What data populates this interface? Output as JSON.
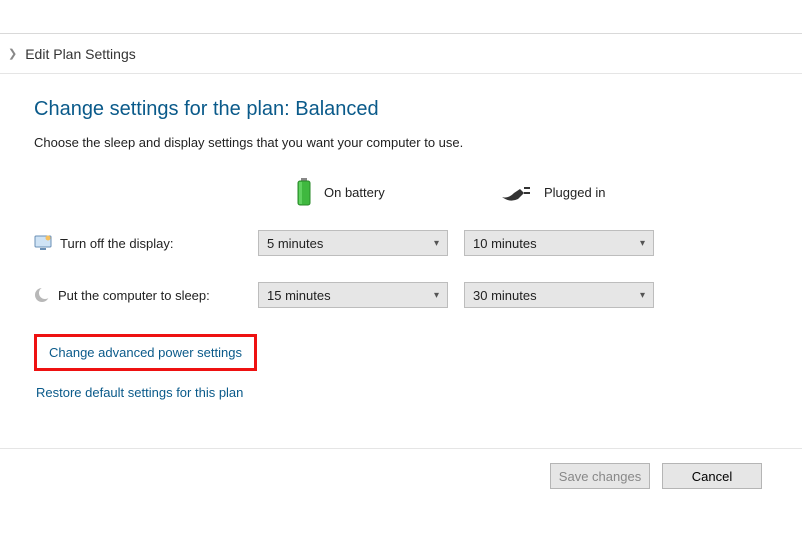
{
  "breadcrumb": {
    "label": "Edit Plan Settings"
  },
  "title": "Change settings for the plan: Balanced",
  "subtitle": "Choose the sleep and display settings that you want your computer to use.",
  "columns": {
    "battery": "On battery",
    "plugged": "Plugged in"
  },
  "rows": {
    "display": {
      "label": "Turn off the display:",
      "battery_value": "5 minutes",
      "plugged_value": "10 minutes"
    },
    "sleep": {
      "label": "Put the computer to sleep:",
      "battery_value": "15 minutes",
      "plugged_value": "30 minutes"
    }
  },
  "links": {
    "advanced": "Change advanced power settings",
    "restore": "Restore default settings for this plan"
  },
  "buttons": {
    "save": "Save changes",
    "cancel": "Cancel"
  }
}
